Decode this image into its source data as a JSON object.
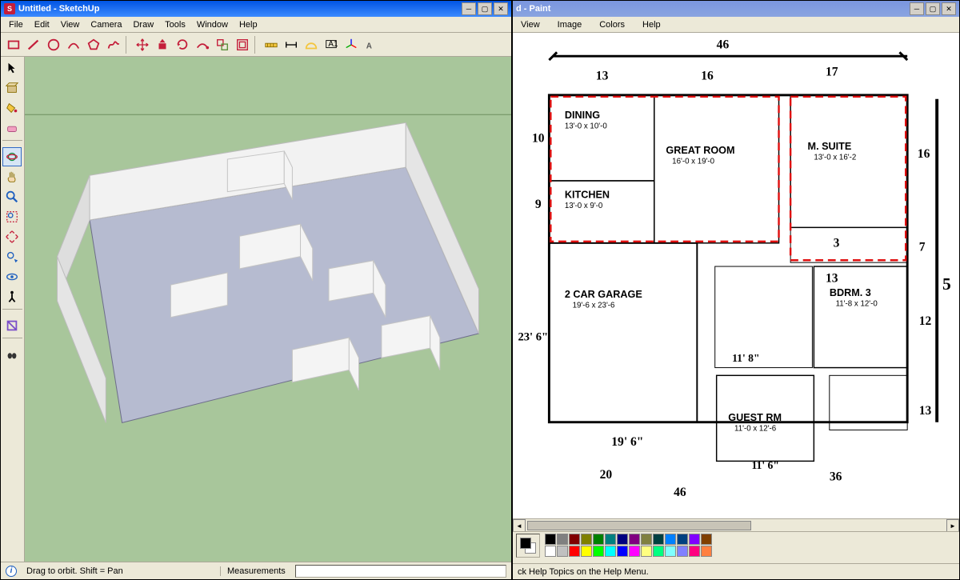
{
  "sketchup": {
    "title": "Untitled - SketchUp",
    "menus": [
      "File",
      "Edit",
      "View",
      "Camera",
      "Draw",
      "Tools",
      "Window",
      "Help"
    ],
    "status_hint": "Drag to orbit.  Shift = Pan",
    "measurements_label": "Measurements",
    "top_tools": [
      {
        "name": "rectangle-icon"
      },
      {
        "name": "line-icon"
      },
      {
        "name": "circle-icon"
      },
      {
        "name": "arc-icon"
      },
      {
        "name": "polygon-icon"
      },
      {
        "name": "freehand-icon"
      },
      {
        "sep": true
      },
      {
        "name": "move-icon"
      },
      {
        "name": "pushpull-icon"
      },
      {
        "name": "rotate-icon"
      },
      {
        "name": "followme-icon"
      },
      {
        "name": "scale-icon"
      },
      {
        "name": "offset-icon"
      },
      {
        "sep": true
      },
      {
        "name": "tape-icon"
      },
      {
        "name": "dimension-icon"
      },
      {
        "name": "protractor-icon"
      },
      {
        "name": "text-icon"
      },
      {
        "name": "axes-icon"
      },
      {
        "name": "3dtext-icon"
      }
    ],
    "side_tools": [
      {
        "name": "select-icon"
      },
      {
        "name": "component-icon"
      },
      {
        "name": "paint-bucket-icon"
      },
      {
        "name": "eraser-icon"
      },
      {
        "sep": true
      },
      {
        "name": "orbit-icon",
        "active": true
      },
      {
        "name": "pan-icon"
      },
      {
        "name": "zoom-icon"
      },
      {
        "name": "zoom-window-icon"
      },
      {
        "name": "zoom-extents-icon"
      },
      {
        "name": "previous-icon"
      },
      {
        "name": "lookaround-icon"
      },
      {
        "name": "walk-icon"
      },
      {
        "sep": true
      },
      {
        "name": "section-icon"
      },
      {
        "sep": true
      },
      {
        "name": "position-camera-icon"
      }
    ]
  },
  "paint": {
    "title": "d - Paint",
    "menus": [
      "View",
      "Image",
      "Colors",
      "Help"
    ],
    "status": "ck Help Topics on the Help Menu.",
    "palette": [
      "#000000",
      "#808080",
      "#800000",
      "#808000",
      "#008000",
      "#008080",
      "#000080",
      "#800080",
      "#808040",
      "#004040",
      "#0080ff",
      "#004080",
      "#8000ff",
      "#804000",
      "#ffffff",
      "#c0c0c0",
      "#ff0000",
      "#ffff00",
      "#00ff00",
      "#00ffff",
      "#0000ff",
      "#ff00ff",
      "#ffff80",
      "#00ff80",
      "#80ffff",
      "#8080ff",
      "#ff0080",
      "#ff8040"
    ],
    "rooms": {
      "dining": {
        "label": "DINING",
        "dim": "13'-0 x 10'-0"
      },
      "great_room": {
        "label": "GREAT ROOM",
        "dim": "16'-0 x 19'-0"
      },
      "m_suite": {
        "label": "M. SUITE",
        "dim": "13'-0 x 16'-2"
      },
      "kitchen": {
        "label": "KITCHEN",
        "dim": "13'-0 x 9'-0"
      },
      "garage": {
        "label": "2 CAR GARAGE",
        "dim": "19'-6 x 23'-6"
      },
      "bdrm3": {
        "label": "BDRM. 3",
        "dim": "11'-8 x 12'-0"
      },
      "guest_rm": {
        "label": "GUEST RM",
        "dim": "11'-0 x 12'-6"
      }
    },
    "dimensions": {
      "top1": "13",
      "top2": "16",
      "top3": "17",
      "top_peak": "46",
      "left1": "10",
      "left2": "9",
      "left3": "23' 6\"",
      "left_19_6": "19' 6\"",
      "left_20": "20",
      "right1": "16",
      "right2": "7",
      "right3": "12",
      "right4": "13",
      "right_tall": "5",
      "mid_11_8": "11' 8\"",
      "mid_11b": "11' 6\"",
      "mid_3": "3",
      "mid_13": "13",
      "bot_46": "46",
      "bot_36": "36"
    }
  }
}
